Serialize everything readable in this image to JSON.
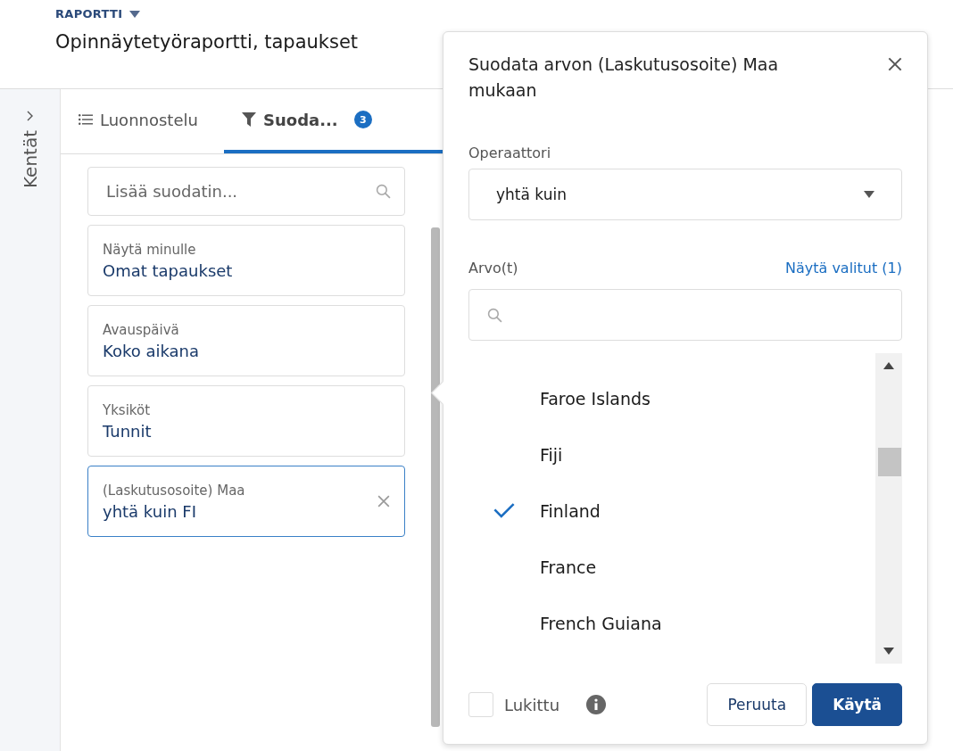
{
  "header": {
    "breadcrumb": "RAPORTTI",
    "title": "Opinnäytetyöraportti, tapaukset"
  },
  "sidebar": {
    "label": "Kentät"
  },
  "tabs": [
    {
      "label": "Luonnostelu",
      "selected": false,
      "kind": "list"
    },
    {
      "label": "Suoda...",
      "selected": true,
      "kind": "filter",
      "badge": "3"
    }
  ],
  "filter_search": {
    "placeholder": "Lisää suodatin..."
  },
  "filters": [
    {
      "label": "Näytä minulle",
      "value": "Omat tapaukset",
      "selected": false,
      "removable": false
    },
    {
      "label": "Avauspäivä",
      "value": "Koko aikana",
      "selected": false,
      "removable": false
    },
    {
      "label": "Yksiköt",
      "value": "Tunnit",
      "selected": false,
      "removable": false
    },
    {
      "label": "(Laskutusosoite) Maa",
      "value": "yhtä kuin FI",
      "selected": true,
      "removable": true
    }
  ],
  "popover": {
    "title": "Suodata arvon (Laskutusosoite) Maa mukaan",
    "operator": {
      "label": "Operaattori",
      "value": "yhtä kuin"
    },
    "values": {
      "label": "Arvo(t)",
      "link": "Näytä valitut (1)",
      "items": [
        {
          "label": "Faroe Islands",
          "checked": false
        },
        {
          "label": "Fiji",
          "checked": false
        },
        {
          "label": "Finland",
          "checked": true
        },
        {
          "label": "France",
          "checked": false
        },
        {
          "label": "French Guiana",
          "checked": false
        }
      ]
    },
    "locked": {
      "label": "Lukittu",
      "checked": false
    },
    "buttons": [
      {
        "label": "Peruuta",
        "kind": "neutral"
      },
      {
        "label": "Käytä",
        "kind": "brand"
      }
    ]
  }
}
